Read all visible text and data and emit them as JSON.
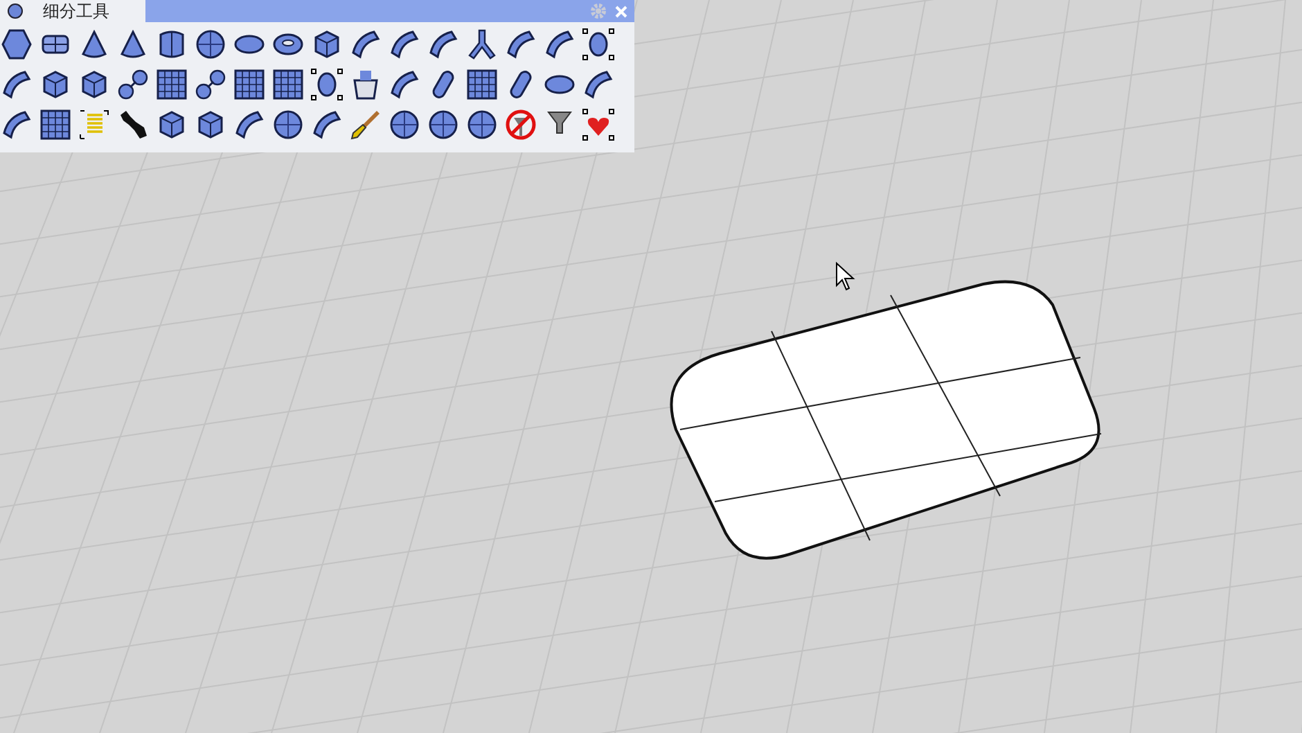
{
  "toolbar": {
    "title": "细分工具",
    "rows": [
      {
        "icons": [
          {
            "kind": "hexagon"
          },
          {
            "kind": "panel"
          },
          {
            "kind": "cone"
          },
          {
            "kind": "cone"
          },
          {
            "kind": "cylinder"
          },
          {
            "kind": "sphere"
          },
          {
            "kind": "ellipsoid"
          },
          {
            "kind": "torus"
          },
          {
            "kind": "box"
          },
          {
            "kind": "surface"
          },
          {
            "kind": "surface"
          },
          {
            "kind": "surface"
          },
          {
            "kind": "branch"
          },
          {
            "kind": "surface"
          },
          {
            "kind": "surface"
          },
          {
            "kind": "points"
          }
        ]
      },
      {
        "icons": [
          {
            "kind": "surface"
          },
          {
            "kind": "box"
          },
          {
            "kind": "box"
          },
          {
            "kind": "spheres"
          },
          {
            "kind": "grid"
          },
          {
            "kind": "spheres"
          },
          {
            "kind": "grid"
          },
          {
            "kind": "grid"
          },
          {
            "kind": "points"
          },
          {
            "kind": "bucket"
          },
          {
            "kind": "surface"
          },
          {
            "kind": "capsule"
          },
          {
            "kind": "grid"
          },
          {
            "kind": "capsule"
          },
          {
            "kind": "ellipsoid"
          },
          {
            "kind": "surface"
          }
        ]
      },
      {
        "icons": [
          {
            "kind": "surface"
          },
          {
            "kind": "grid"
          },
          {
            "kind": "lines"
          },
          {
            "kind": "wrench"
          },
          {
            "kind": "box"
          },
          {
            "kind": "box"
          },
          {
            "kind": "surface"
          },
          {
            "kind": "sphere"
          },
          {
            "kind": "surface"
          },
          {
            "kind": "brush"
          },
          {
            "kind": "sphere"
          },
          {
            "kind": "sphere"
          },
          {
            "kind": "sphere"
          },
          {
            "kind": "prohibited"
          },
          {
            "kind": "filter"
          },
          {
            "kind": "heart"
          }
        ]
      }
    ]
  }
}
